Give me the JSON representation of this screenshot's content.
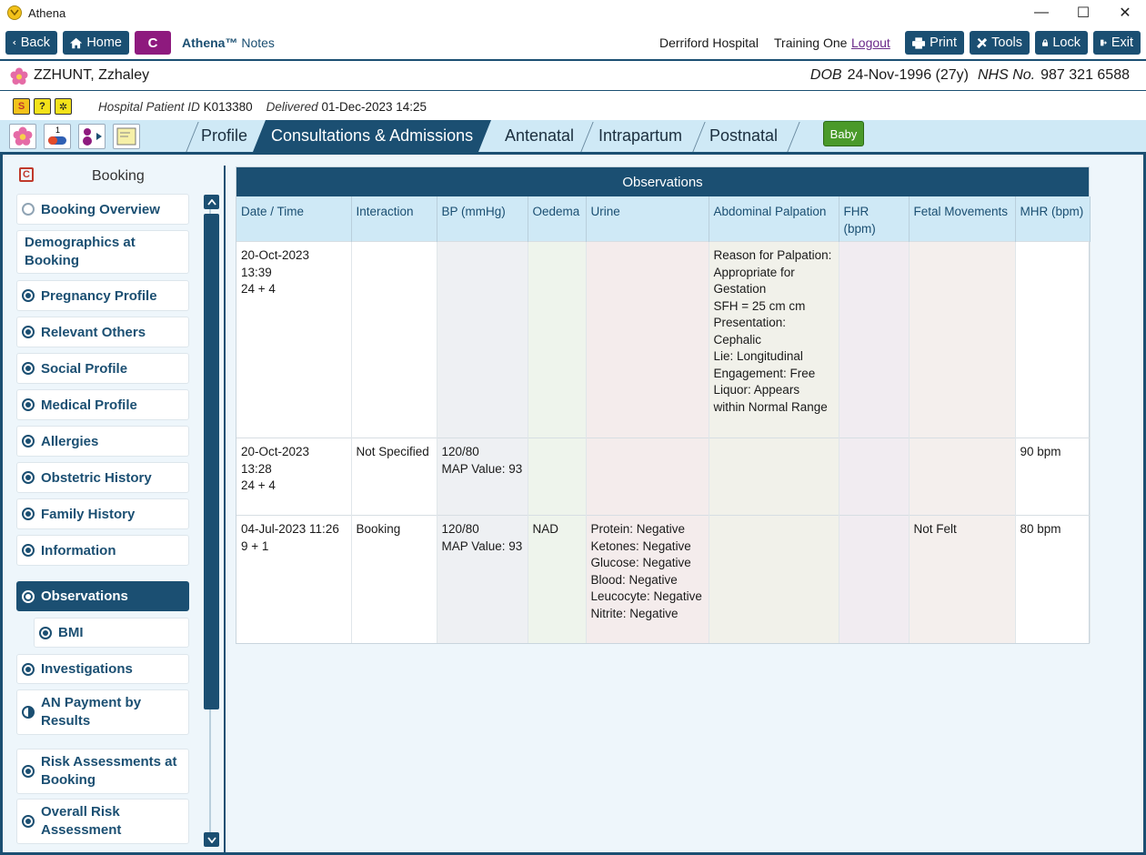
{
  "window": {
    "title": "Athena",
    "minimize": "—",
    "maximize": "☐",
    "close": "✕"
  },
  "toolbar": {
    "back": "Back",
    "home": "Home",
    "c_label": "C",
    "app_name_bold": "Athena™",
    "app_name_rest": " Notes",
    "hospital": "Derriford Hospital",
    "user": "Training One",
    "logout": "Logout",
    "print": "Print",
    "tools": "Tools",
    "lock": "Lock",
    "exit": "Exit"
  },
  "patient": {
    "name": "ZZHUNT, Zzhaley",
    "dob_label": "DOB",
    "dob_value": "24-Nov-1996 (27y)",
    "nhs_label": "NHS No.",
    "nhs_value": "987 321 6588",
    "pid_label": "Hospital Patient ID",
    "pid_value": "K013380",
    "delivered_label": "Delivered",
    "delivered_value": "01-Dec-2023 14:25"
  },
  "tabs": [
    "Profile",
    "Consultations & Admissions",
    "Antenatal",
    "Intrapartum",
    "Postnatal"
  ],
  "baby_button": "Baby",
  "sidebar": {
    "title": "Booking",
    "items": [
      "Booking Overview",
      "Demographics at Booking",
      "Pregnancy Profile",
      "Relevant Others",
      "Social Profile",
      "Medical Profile",
      "Allergies",
      "Obstetric History",
      "Family History",
      "Information",
      "Observations",
      "BMI",
      "Investigations",
      "AN Payment by Results",
      "Risk Assessments at Booking",
      "Overall Risk Assessment"
    ]
  },
  "observations": {
    "title": "Observations",
    "columns": [
      "Date / Time",
      "Interaction",
      "BP (mmHg)",
      "Oedema",
      "Urine",
      "Abdominal Palpation",
      "FHR (bpm)",
      "Fetal Movements",
      "MHR (bpm)"
    ],
    "rows": [
      [
        "20-Oct-2023\n13:39\n24 + 4",
        "",
        "",
        "",
        "",
        "Reason for Palpation: Appropriate for Gestation\nSFH = 25 cm cm\nPresentation: Cephalic\nLie: Longitudinal\nEngagement: Free\nLiquor: Appears within Normal Range",
        "",
        "",
        ""
      ],
      [
        "20-Oct-2023\n13:28\n24 + 4",
        "Not Specified",
        "120/80\nMAP Value: 93",
        "",
        "",
        "",
        "",
        "",
        "90 bpm"
      ],
      [
        "04-Jul-2023 11:26\n9 + 1",
        "Booking",
        "120/80\nMAP Value: 93",
        "NAD",
        "Protein: Negative\nKetones: Negative\nGlucose: Negative\nBlood: Negative\nLeucocyte: Negative\nNitrite: Negative",
        "",
        "",
        "Not Felt",
        "80 bpm"
      ]
    ]
  }
}
